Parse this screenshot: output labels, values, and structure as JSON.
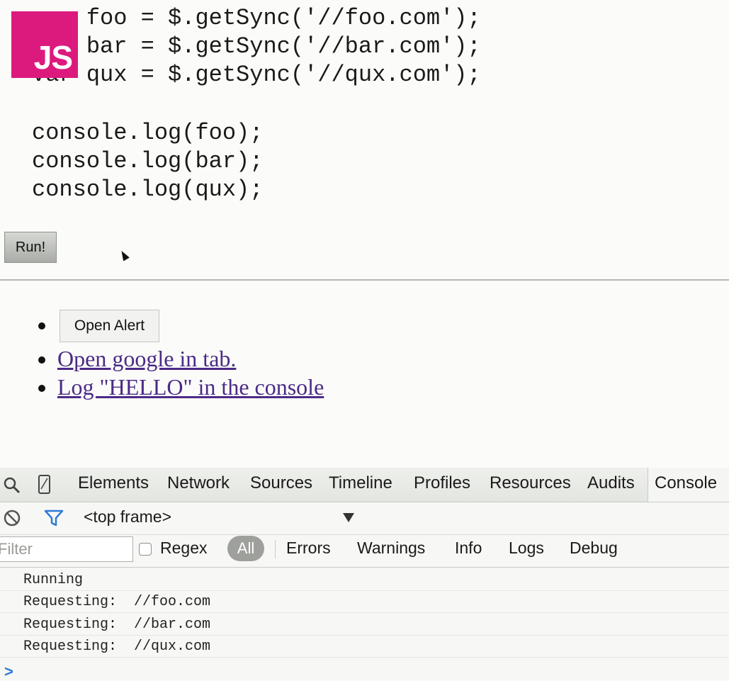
{
  "code": {
    "lines": [
      "    foo = $.getSync('//foo.com');",
      "    bar = $.getSync('//bar.com');",
      "var qux = $.getSync('//qux.com');",
      "",
      "console.log(foo);",
      "console.log(bar);",
      "console.log(qux);"
    ]
  },
  "logo": {
    "label": "JS",
    "color": "#dc1a7e"
  },
  "run_button": {
    "label": "Run!"
  },
  "list": {
    "alert_button": "Open Alert",
    "links": [
      "Open google in tab.",
      "Log \"HELLO\" in the console"
    ]
  },
  "devtools": {
    "tabs": [
      "Elements",
      "Network",
      "Sources",
      "Timeline",
      "Profiles",
      "Resources",
      "Audits",
      "Console"
    ],
    "active_tab": "Console",
    "frame_select": "<top frame>",
    "filter_placeholder": "Filter",
    "regex_label": "Regex",
    "levels": [
      "All",
      "Errors",
      "Warnings",
      "Info",
      "Logs",
      "Debug"
    ],
    "active_level": "All",
    "console_lines": [
      "Running",
      "Requesting:  //foo.com",
      "Requesting:  //bar.com",
      "Requesting:  //qux.com"
    ],
    "prompt_symbol": ">"
  }
}
